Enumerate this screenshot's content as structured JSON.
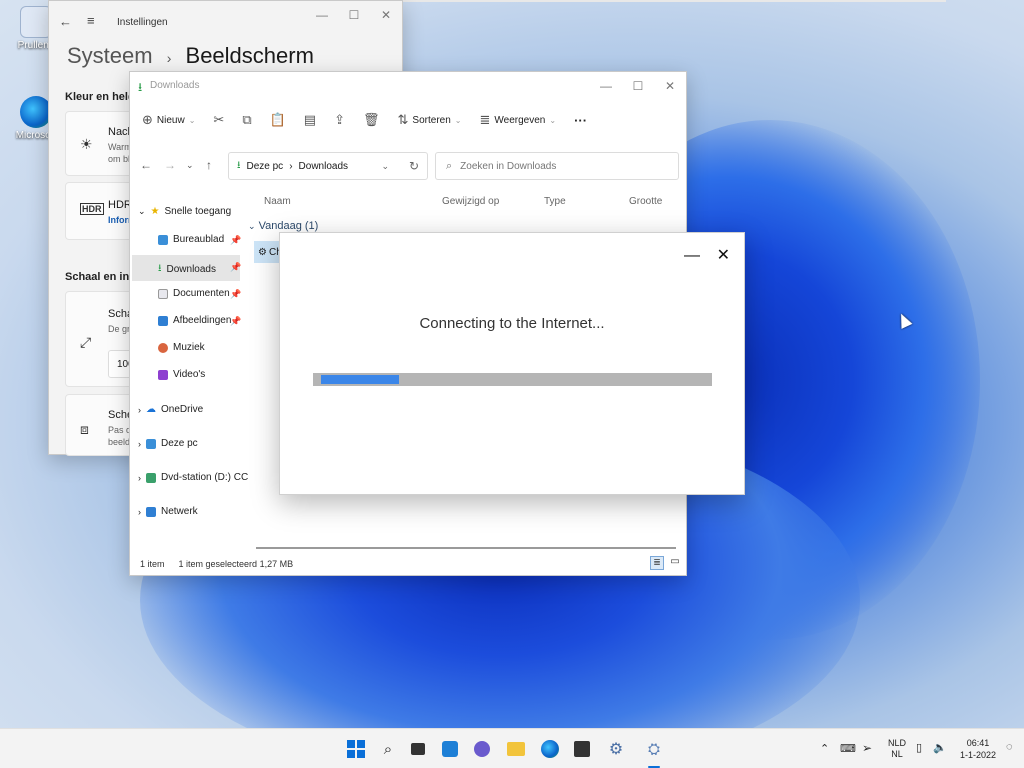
{
  "desktop": {
    "icons": [
      {
        "label": "Prullenb",
        "icon": "recycle-bin-icon"
      },
      {
        "label": "Microsoft",
        "icon": "edge-icon"
      }
    ]
  },
  "settings": {
    "title": "Instellingen",
    "breadcrumb_parent": "Systeem",
    "breadcrumb_sep": "›",
    "breadcrumb_current": "Beeldscherm",
    "section1": "Kleur en helde",
    "card_night_title": "Nach",
    "card_night_sub1": "Warm",
    "card_night_sub2": "om bl",
    "card_hdr_title": "HDR",
    "card_hdr_link": "Inform",
    "section2": "Schaal en inde",
    "card_scale_title": "Schaa",
    "card_scale_sub": "De gr",
    "card_scale_value": "100",
    "card_screen_title": "Scher",
    "card_screen_sub1": "Pas de",
    "card_screen_sub2": "beeld"
  },
  "explorer": {
    "title": "Downloads",
    "toolbar": {
      "new": "Nieuw",
      "sort": "Sorteren",
      "view": "Weergeven",
      "more": "···"
    },
    "address": {
      "root": "Deze pc",
      "sep": "›",
      "current": "Downloads"
    },
    "search_placeholder": "Zoeken in Downloads",
    "columns": {
      "name": "Naam",
      "modified": "Gewijzigd op",
      "type": "Type",
      "size": "Grootte"
    },
    "nav": {
      "quick_access": "Snelle toegang",
      "desktop": "Bureaublad",
      "downloads": "Downloads",
      "documents": "Documenten",
      "pictures": "Afbeeldingen",
      "music": "Muziek",
      "videos": "Video's",
      "onedrive": "OneDrive",
      "this_pc": "Deze pc",
      "dvd": "Dvd-station (D:) CC",
      "network": "Netwerk"
    },
    "group_label": "Vandaag (1)",
    "file_name": "Ch",
    "status": {
      "count": "1 item",
      "selected": "1 item geselecteerd",
      "size": "1,27 MB"
    }
  },
  "dialog": {
    "message": "Connecting to the Internet...",
    "progress": 0.2
  },
  "taskbar": {
    "lang1": "NLD",
    "lang2": "NL",
    "time": "06:41",
    "date": "1-1-2022"
  }
}
